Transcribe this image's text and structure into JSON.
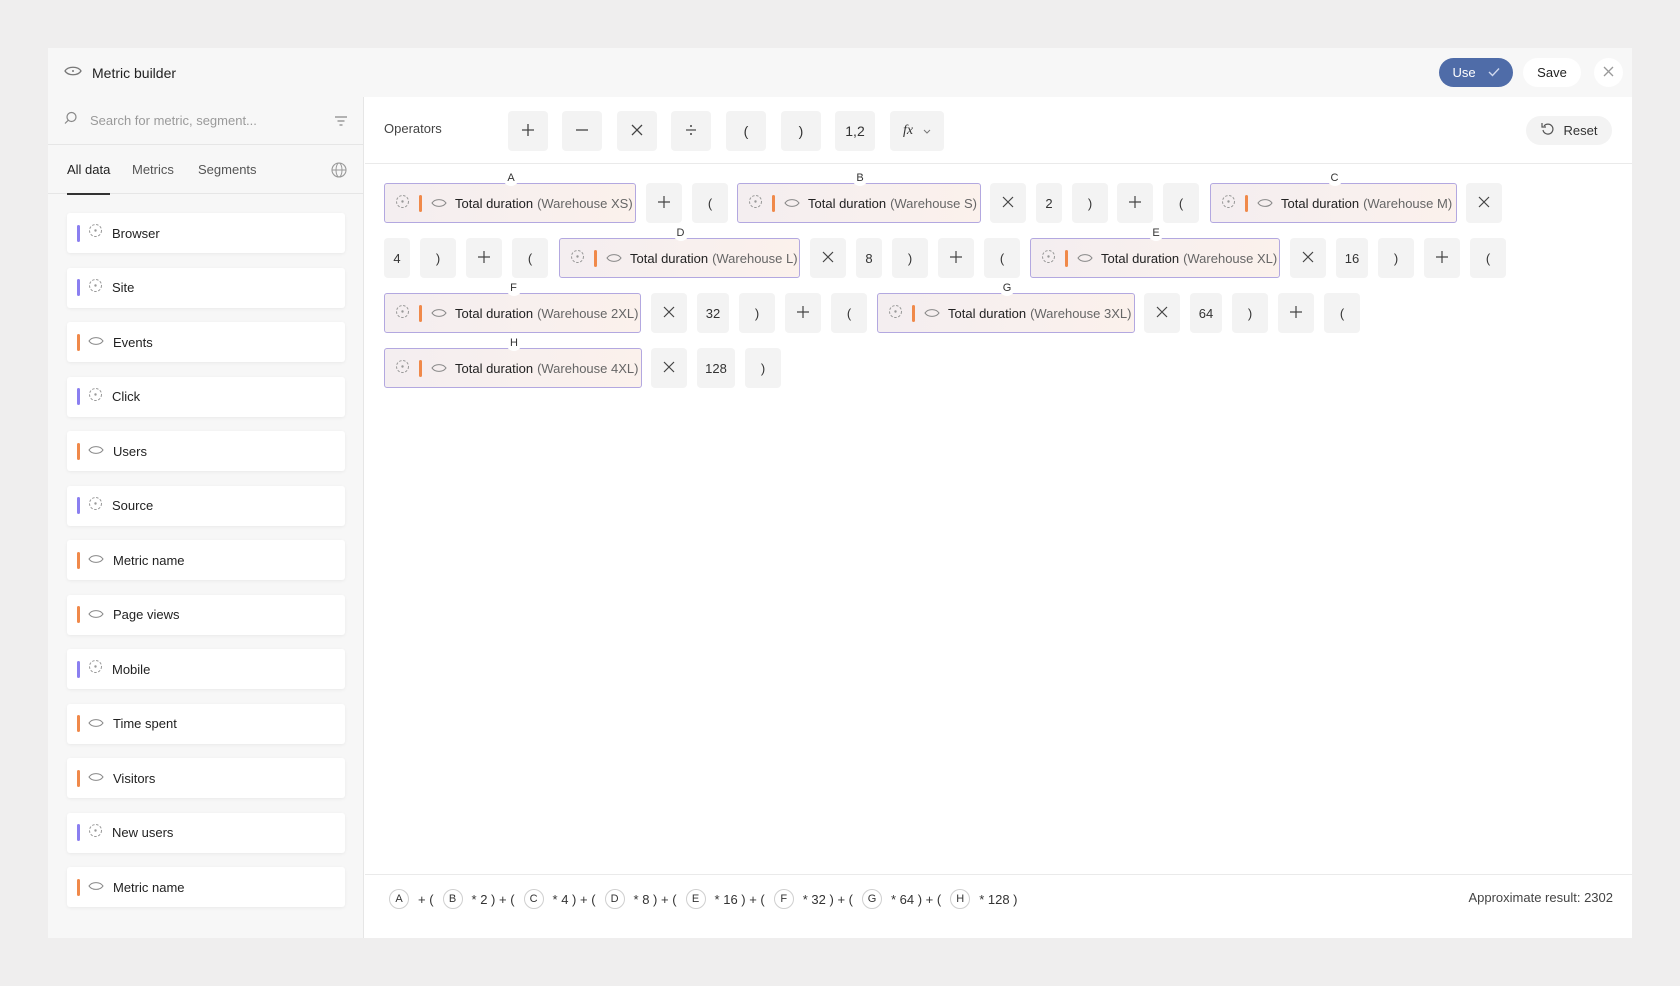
{
  "window": {
    "title": "Metric builder"
  },
  "header": {
    "use_label": "Use",
    "save_label": "Save"
  },
  "sidebar": {
    "search_placeholder": "Search for metric, segment...",
    "tabs": [
      "All data",
      "Metrics",
      "Segments"
    ],
    "items": [
      {
        "label": "Browser",
        "color": "#8b7ff0"
      },
      {
        "label": "Site",
        "color": "#8b7ff0"
      },
      {
        "label": "Events",
        "color": "#f0894a"
      },
      {
        "label": "Click",
        "color": "#8b7ff0"
      },
      {
        "label": "Users",
        "color": "#f0894a"
      },
      {
        "label": "Source",
        "color": "#8b7ff0"
      },
      {
        "label": "Metric name",
        "color": "#f0894a"
      },
      {
        "label": "Page views",
        "color": "#f0894a"
      },
      {
        "label": "Mobile",
        "color": "#8b7ff0"
      },
      {
        "label": "Time spent",
        "color": "#f0894a"
      },
      {
        "label": "Visitors",
        "color": "#f0894a"
      },
      {
        "label": "New users",
        "color": "#8b7ff0"
      },
      {
        "label": "Metric name",
        "color": "#f0894a"
      }
    ]
  },
  "operators": {
    "label": "Operators",
    "items": [
      "+",
      "−",
      "×",
      "÷",
      "(",
      ")",
      "1,2",
      "fx"
    ],
    "reset_label": "Reset"
  },
  "expression": {
    "metric_name": "Total duration",
    "metrics": [
      {
        "letter": "A",
        "sub": "(Warehouse XS)"
      },
      {
        "letter": "B",
        "sub": "(Warehouse S)"
      },
      {
        "letter": "C",
        "sub": "(Warehouse M)"
      },
      {
        "letter": "D",
        "sub": "(Warehouse L)"
      },
      {
        "letter": "E",
        "sub": "(Warehouse XL)"
      },
      {
        "letter": "F",
        "sub": "(Warehouse 2XL)"
      },
      {
        "letter": "G",
        "sub": "(Warehouse 3XL)"
      },
      {
        "letter": "H",
        "sub": "(Warehouse 4XL)"
      }
    ],
    "numbers": [
      "2",
      "4",
      "8",
      "16",
      "32",
      "64",
      "128"
    ]
  },
  "footer": {
    "formula_ops": [
      "+ (",
      "* 2 ) + (",
      "* 4 ) + (",
      "* 8 ) + (",
      "* 16 ) + (",
      "* 32 ) + (",
      "* 64 ) + (",
      "* 128 )"
    ],
    "result_label": "Approximate result:",
    "result_value": "2302"
  },
  "colors": {
    "accent": "#4f6ca8",
    "metric_border": "#b3a8e0",
    "orange": "#f0894a",
    "purple": "#8b7ff0"
  }
}
